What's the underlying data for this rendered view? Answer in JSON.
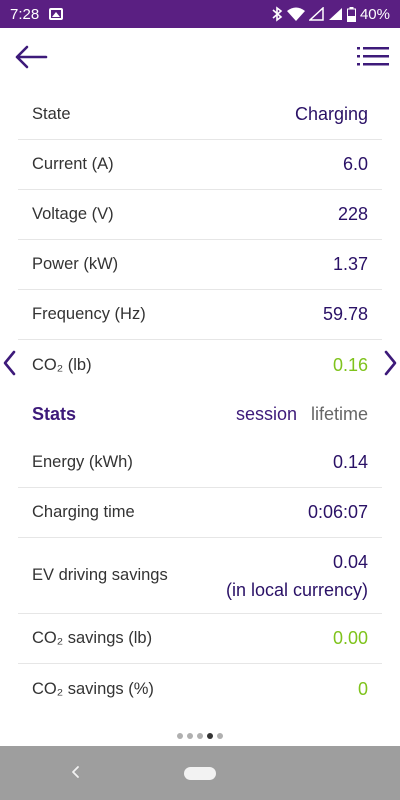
{
  "status_bar": {
    "time": "7:28",
    "battery": "40%"
  },
  "colors": {
    "status_bar": "#5a1f82",
    "accent": "#3d1a7a",
    "value": "#2a1166",
    "green": "#7fc31c",
    "nav_bar": "#9e9e9e"
  },
  "icons": {
    "back": "back-arrow-icon",
    "menu": "list-menu-icon",
    "prev": "chevron-left-icon",
    "next": "chevron-right-icon"
  },
  "readings": [
    {
      "label": "State",
      "value": "Charging"
    },
    {
      "label": "Current (A)",
      "value": "6.0"
    },
    {
      "label": "Voltage (V)",
      "value": "228"
    },
    {
      "label": "Power (kW)",
      "value": "1.37"
    },
    {
      "label": "Frequency (Hz)",
      "value": "59.78"
    },
    {
      "label": "CO₂ (lb)",
      "value": "0.16"
    }
  ],
  "stats": {
    "title": "Stats",
    "tabs": [
      "session",
      "lifetime"
    ],
    "selected_tab": "session",
    "rows": [
      {
        "label": "Energy (kWh)",
        "value": "0.14"
      },
      {
        "label": "Charging time",
        "value": "0:06:07"
      },
      {
        "label": "EV driving savings",
        "value": "0.04",
        "value_sub": "(in local currency)"
      },
      {
        "label": "CO₂ savings (lb)",
        "value": "0.00"
      },
      {
        "label": "CO₂ savings (%)",
        "value": "0"
      }
    ]
  },
  "pager": {
    "pages": 5,
    "current_page": 4
  }
}
